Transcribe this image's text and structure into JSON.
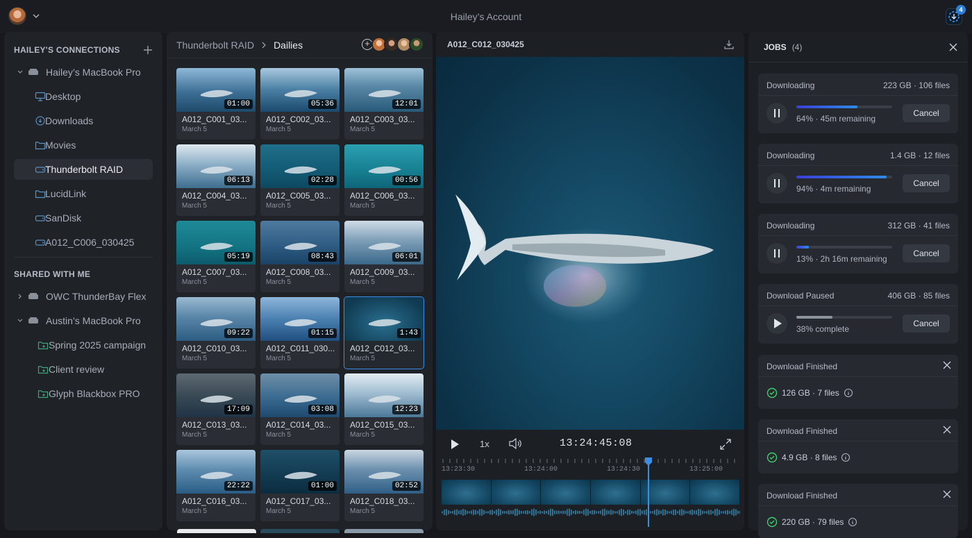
{
  "app": {
    "title": "Hailey’s Account",
    "download_badge": "4"
  },
  "sidebar": {
    "connections_header": "HAILEY'S CONNECTIONS",
    "items": [
      {
        "label": "Hailey’s MacBook Pro",
        "icon": "drive-icon"
      },
      {
        "label": "Desktop",
        "icon": "desktop-icon"
      },
      {
        "label": "Downloads",
        "icon": "download-circle-icon"
      },
      {
        "label": "Movies",
        "icon": "folder-icon"
      },
      {
        "label": "Thunderbolt RAID",
        "icon": "external-drive-icon"
      },
      {
        "label": "LucidLink",
        "icon": "folder-icon"
      },
      {
        "label": "SanDisk",
        "icon": "external-drive-icon"
      },
      {
        "label": "A012_C006_030425",
        "icon": "external-drive-icon"
      }
    ],
    "shared_header": "SHARED WITH ME",
    "shared": [
      {
        "label": "OWC ThunderBay Flex",
        "icon": "drive-icon"
      },
      {
        "label": "Austin’s MacBook Pro",
        "icon": "drive-icon"
      },
      {
        "label": "Spring 2025 campaign",
        "icon": "shared-folder-icon"
      },
      {
        "label": "Client review",
        "icon": "shared-folder-icon"
      },
      {
        "label": "Glyph Blackbox PRO",
        "icon": "shared-folder-icon"
      }
    ]
  },
  "browser": {
    "crumb_root": "Thunderbolt RAID",
    "crumb_current": "Dailies",
    "clips": [
      {
        "name": "A012_C001_03...",
        "date": "March 5",
        "dur": "01:00"
      },
      {
        "name": "A012_C002_03...",
        "date": "March 5",
        "dur": "05:36"
      },
      {
        "name": "A012_C003_03...",
        "date": "March 5",
        "dur": "12:01"
      },
      {
        "name": "A012_C004_03...",
        "date": "March 5",
        "dur": "06:13"
      },
      {
        "name": "A012_C005_03...",
        "date": "March 5",
        "dur": "02:28"
      },
      {
        "name": "A012_C006_03...",
        "date": "March 5",
        "dur": "00:56"
      },
      {
        "name": "A012_C007_03...",
        "date": "March 5",
        "dur": "05:19"
      },
      {
        "name": "A012_C008_03...",
        "date": "March 5",
        "dur": "08:43"
      },
      {
        "name": "A012_C009_03...",
        "date": "March 5",
        "dur": "06:01"
      },
      {
        "name": "A012_C010_03...",
        "date": "March 5",
        "dur": "09:22"
      },
      {
        "name": "A012_C011_030...",
        "date": "March 5",
        "dur": "01:15"
      },
      {
        "name": "A012_C012_03...",
        "date": "March 5",
        "dur": "1:43"
      },
      {
        "name": "A012_C013_03...",
        "date": "March 5",
        "dur": "17:09"
      },
      {
        "name": "A012_C014_03...",
        "date": "March 5",
        "dur": "03:08"
      },
      {
        "name": "A012_C015_03...",
        "date": "March 5",
        "dur": "12:23"
      },
      {
        "name": "A012_C016_03...",
        "date": "March 5",
        "dur": "22:22"
      },
      {
        "name": "A012_C017_03...",
        "date": "March 5",
        "dur": "01:00"
      },
      {
        "name": "A012_C018_03...",
        "date": "March 5",
        "dur": "02:52"
      }
    ]
  },
  "viewer": {
    "title": "A012_C012_030425",
    "speed": "1x",
    "timecode": "13:24:45:08",
    "ticks": [
      "13:23:30",
      "13:24:00",
      "13:24:30",
      "13:25:00"
    ],
    "playhead_fraction": 0.69
  },
  "jobs": {
    "title": "JOBS",
    "count": "(4)",
    "cancel_label": "Cancel",
    "active": [
      {
        "status": "Downloading",
        "size": "223 GB · 106 files",
        "progress": 0.64,
        "detail": "64%  ·  45m remaining",
        "state": "pause"
      },
      {
        "status": "Downloading",
        "size": "1.4 GB · 12 files",
        "progress": 0.94,
        "detail": "94%  ·  4m remaining",
        "state": "pause"
      },
      {
        "status": "Downloading",
        "size": "312 GB · 41 files",
        "progress": 0.13,
        "detail": "13%  ·  2h 16m remaining",
        "state": "pause"
      },
      {
        "status": "Download Paused",
        "size": "406 GB · 85 files",
        "progress": 0.38,
        "detail": "38% complete",
        "state": "play"
      }
    ],
    "finished": [
      {
        "status": "Download Finished",
        "summary": "126 GB · 7 files"
      },
      {
        "status": "Download Finished",
        "summary": "4.9 GB · 8 files"
      },
      {
        "status": "Download Finished",
        "summary": "220 GB · 79 files"
      }
    ]
  }
}
